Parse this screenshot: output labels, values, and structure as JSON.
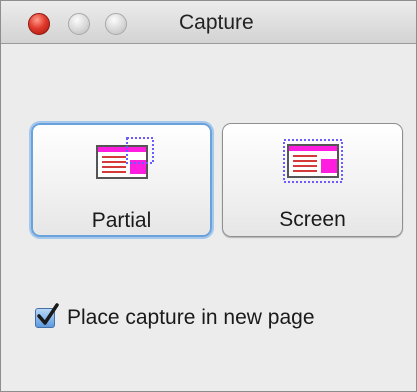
{
  "window": {
    "title": "Capture",
    "controls": [
      "close-button",
      "minimize-button",
      "zoom-button"
    ]
  },
  "buttons": {
    "partial_label": "Partial",
    "screen_label": "Screen",
    "partial_icon": "partial-capture-icon",
    "screen_icon": "screen-capture-icon",
    "focused": "Partial"
  },
  "options": {
    "place_in_new_page": {
      "label": "Place capture in new page",
      "checked": true
    }
  },
  "colors": {
    "accent_magenta": "#ff1ee0",
    "focus_ring": "#6aa3dc",
    "check_blue": "#5d9ae0"
  }
}
